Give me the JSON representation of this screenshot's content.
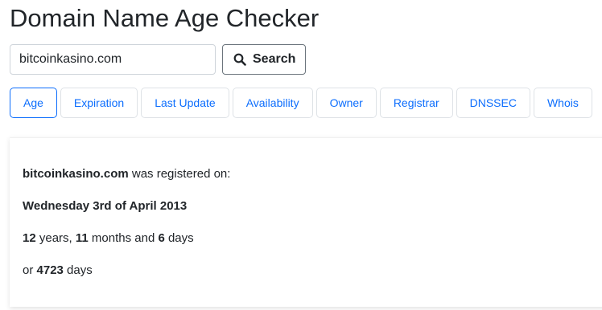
{
  "page_title": "Domain Name Age Checker",
  "search": {
    "input_value": "bitcoinkasino.com",
    "button_label": "Search",
    "button_icon": "search-icon"
  },
  "tabs": [
    {
      "label": "Age",
      "active": true
    },
    {
      "label": "Expiration",
      "active": false
    },
    {
      "label": "Last Update",
      "active": false
    },
    {
      "label": "Availability",
      "active": false
    },
    {
      "label": "Owner",
      "active": false
    },
    {
      "label": "Registrar",
      "active": false
    },
    {
      "label": "DNSSEC",
      "active": false
    },
    {
      "label": "Whois",
      "active": false
    }
  ],
  "result": {
    "domain": "bitcoinkasino.com",
    "registered_text": " was registered on:",
    "registered_date": "Wednesday 3rd of April 2013",
    "years": "12",
    "years_label": " years, ",
    "months": "11",
    "months_label": " months and ",
    "days": "6",
    "days_label": " days",
    "or_label": "or ",
    "total_days": "4723",
    "total_days_label": " days"
  },
  "colors": {
    "accent": "#0d6efd",
    "text": "#212529",
    "border": "#dee2e6"
  }
}
